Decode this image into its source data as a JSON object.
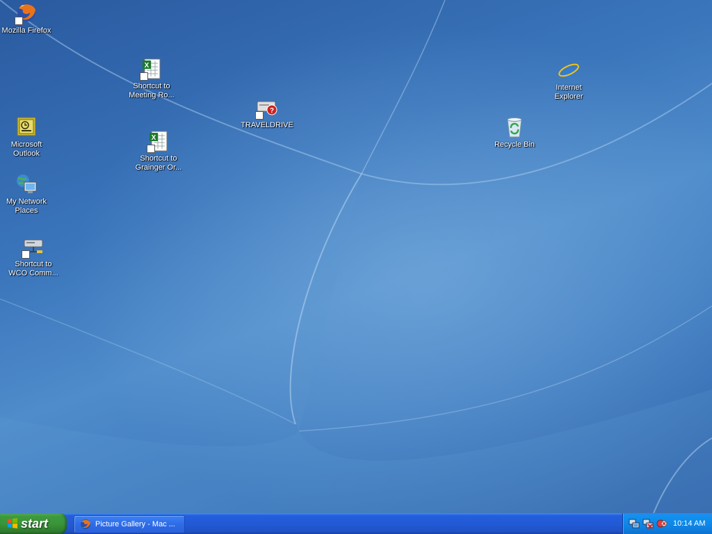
{
  "desktop": {
    "icons": [
      {
        "label": "Mozilla Firefox",
        "icon": "firefox-icon"
      },
      {
        "label": "Shortcut to\nMeeting Ro...",
        "icon": "excel-shortcut-icon"
      },
      {
        "label": "TRAVELDRIVE",
        "icon": "missing-drive-icon"
      },
      {
        "label": "Internet\nExplorer",
        "icon": "internet-explorer-icon"
      },
      {
        "label": "Recycle Bin",
        "icon": "recycle-bin-icon"
      },
      {
        "label": "Microsoft\nOutlook",
        "icon": "outlook-icon"
      },
      {
        "label": "Shortcut to\nGrainger Or...",
        "icon": "excel-shortcut-icon"
      },
      {
        "label": "My Network\nPlaces",
        "icon": "network-places-icon"
      },
      {
        "label": "Shortcut to\nWCO Comm...",
        "icon": "network-drive-icon"
      }
    ]
  },
  "taskbar": {
    "start_label": "start",
    "tasks": [
      {
        "label": "Picture Gallery - Mac ...",
        "icon": "firefox-icon"
      }
    ],
    "tray": {
      "icons": [
        "network-icon",
        "network-disconnected-icon",
        "security-icon"
      ],
      "clock": "10:14 AM"
    }
  },
  "colors": {
    "desktop_blue": "#3a75bb",
    "taskbar_blue": "#245edc",
    "start_green": "#3d9a3d",
    "tray_blue": "#0f85e6"
  }
}
